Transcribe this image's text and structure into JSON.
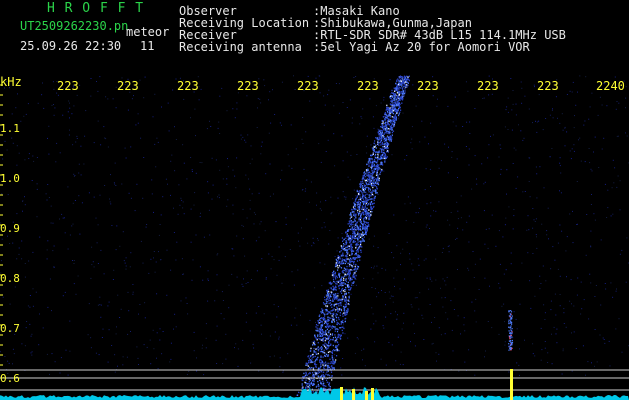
{
  "header": {
    "title": "H R O F F T",
    "filename": "UT2509262230.pn",
    "tag": "meteor",
    "datetime": "25.09.26 22:30",
    "count": "11",
    "fields": [
      {
        "label": "Observer",
        "value": ":Masaki Kano"
      },
      {
        "label": "Receiving Location",
        "value": ":Shibukawa,Gunma,Japan"
      },
      {
        "label": "Receiver",
        "value": ":RTL-SDR SDR# 43dB L15 114.1MHz USB"
      },
      {
        "label": "Receiving antenna",
        "value": ":5el Yagi Az 20 for Aomori VOR"
      }
    ]
  },
  "axes": {
    "unit": "kHz",
    "time_ticks": [
      "223",
      "223",
      "223",
      "223",
      "223",
      "223",
      "223",
      "223",
      "223",
      "2240"
    ],
    "freq_ticks": [
      "1.1",
      "1.0",
      "0.9",
      "0.8",
      "0.7",
      "0.6"
    ]
  },
  "colors": {
    "background": "#000000",
    "labels": "#ffff33",
    "signal": "#3a5cff",
    "baseline": "#00e5ff"
  }
}
